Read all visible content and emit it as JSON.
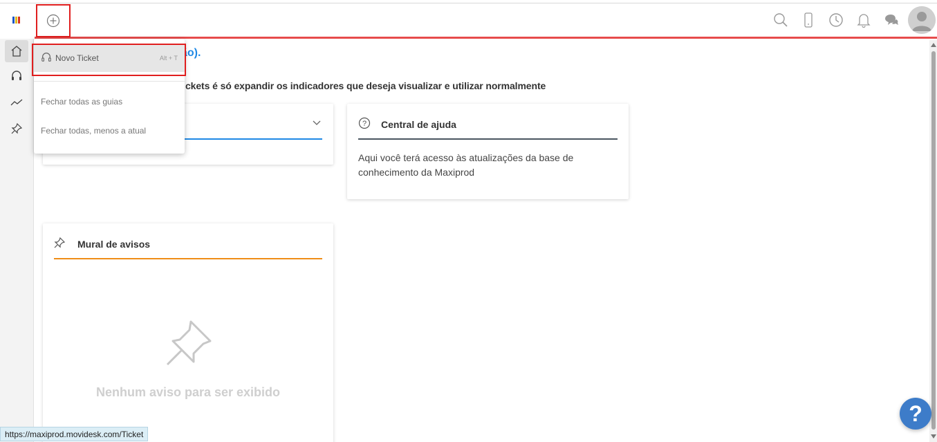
{
  "header": {
    "add_icon": "plus-circle-icon",
    "icons": [
      "search-icon",
      "mobile-icon",
      "clock-icon",
      "bell-icon",
      "chat-icon"
    ],
    "avatar_icon": "user-avatar-icon"
  },
  "logo": {
    "colors": [
      "#1a56c8",
      "#e0b81d",
      "#d93025"
    ]
  },
  "sidebar": {
    "items": [
      {
        "name": "home",
        "icon": "home-icon",
        "active": true
      },
      {
        "name": "tickets",
        "icon": "headset-icon"
      },
      {
        "name": "reports",
        "icon": "trend-line-icon"
      },
      {
        "name": "pinned",
        "icon": "pin-icon"
      }
    ]
  },
  "main": {
    "heading_partial": "ão).",
    "subtext_partial": "ckets é só expandir os indicadores que deseja visualizar e utilizar normalmente"
  },
  "help_card": {
    "title": "Central de ajuda",
    "body": "Aqui você terá acesso às atualizações da base de conhecimento da Maxiprod"
  },
  "notice_card": {
    "title": "Mural de avisos",
    "empty_text": "Nenhum aviso para ser exibido"
  },
  "dropdown": {
    "new_ticket_label": "Novo Ticket",
    "new_ticket_shortcut": "Alt + T",
    "close_all_label": "Fechar todas as guias",
    "close_others_label": "Fechar todas, menos a atual"
  },
  "help_button": {
    "label": "?"
  },
  "status_url": "https://maxiprod.movidesk.com/Ticket",
  "colors": {
    "accent_red": "#e74c4c",
    "link_blue": "#1e88e5",
    "notice_orange": "#ef8c17",
    "highlight_box": "#e01e1e"
  }
}
